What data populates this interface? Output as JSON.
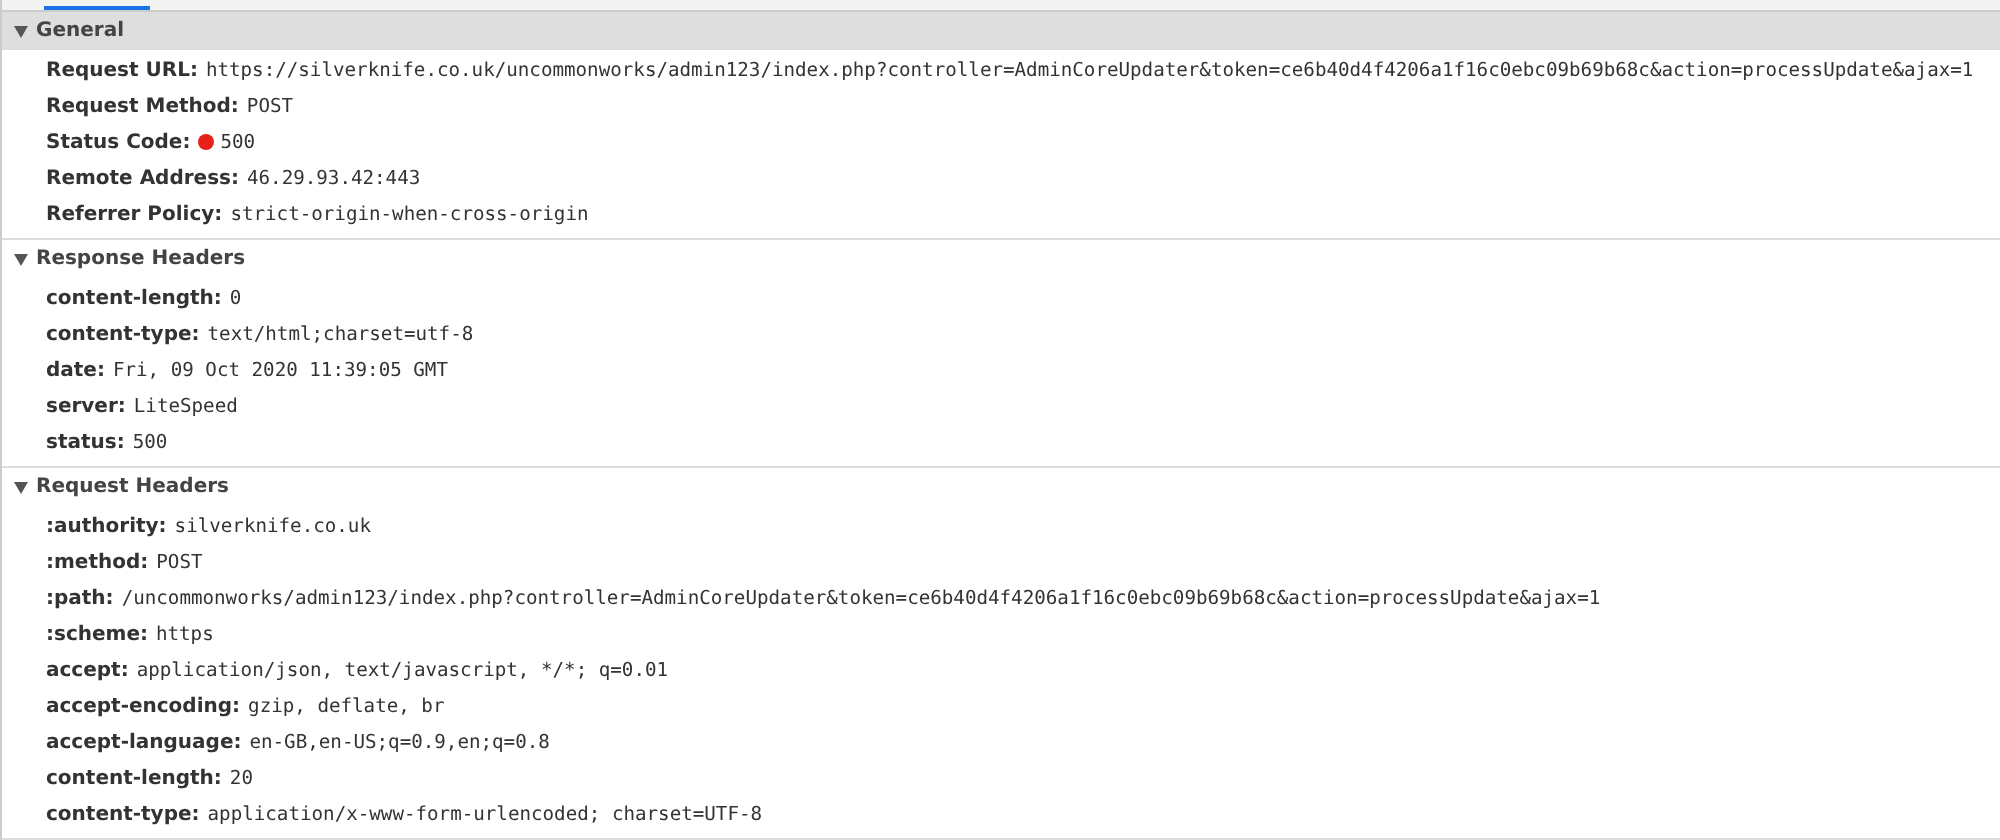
{
  "sections": [
    {
      "title": "General",
      "expanded": true,
      "selected": true,
      "rows": [
        {
          "name": "Request URL:",
          "value": "https://silverknife.co.uk/uncommonworks/admin123/index.php?controller=AdminCoreUpdater&token=ce6b40d4f4206a1f16c0ebc09b69b68c&action=processUpdate&ajax=1"
        },
        {
          "name": "Request Method:",
          "value": "POST"
        },
        {
          "name": "Status Code:",
          "value": "500",
          "color": "#e8201a"
        },
        {
          "name": "Remote Address:",
          "value": "46.29.93.42:443"
        },
        {
          "name": "Referrer Policy:",
          "value": "strict-origin-when-cross-origin"
        }
      ]
    },
    {
      "title": "Response Headers",
      "expanded": true,
      "selected": false,
      "rows": [
        {
          "name": "content-length:",
          "value": "0"
        },
        {
          "name": "content-type:",
          "value": "text/html;charset=utf-8"
        },
        {
          "name": "date:",
          "value": "Fri, 09 Oct 2020 11:39:05 GMT"
        },
        {
          "name": "server:",
          "value": "LiteSpeed"
        },
        {
          "name": "status:",
          "value": "500"
        }
      ]
    },
    {
      "title": "Request Headers",
      "expanded": true,
      "selected": false,
      "rows": [
        {
          "name": ":authority:",
          "value": "silverknife.co.uk"
        },
        {
          "name": ":method:",
          "value": "POST"
        },
        {
          "name": ":path:",
          "value": "/uncommonworks/admin123/index.php?controller=AdminCoreUpdater&token=ce6b40d4f4206a1f16c0ebc09b69b68c&action=processUpdate&ajax=1"
        },
        {
          "name": ":scheme:",
          "value": "https"
        },
        {
          "name": "accept:",
          "value": "application/json, text/javascript, */*; q=0.01"
        },
        {
          "name": "accept-encoding:",
          "value": "gzip, deflate, br"
        },
        {
          "name": "accept-language:",
          "value": "en-GB,en-US;q=0.9,en;q=0.8"
        },
        {
          "name": "content-length:",
          "value": "20"
        },
        {
          "name": "content-type:",
          "value": "application/x-www-form-urlencoded; charset=UTF-8"
        }
      ]
    }
  ]
}
